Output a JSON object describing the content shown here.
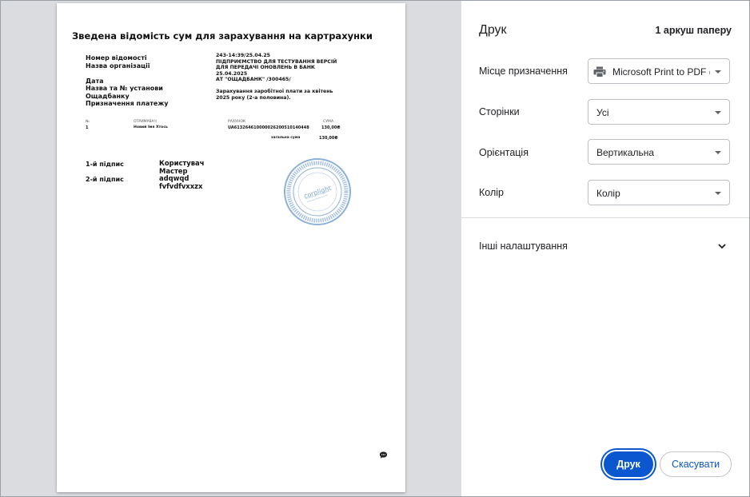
{
  "document": {
    "title": "Зведена відомість сум для зарахування на картрахунки",
    "meta_labels": [
      "Номер відомості",
      "Назва організації",
      "",
      "Дата",
      "Назва та № установи",
      "Ощадбанку",
      "Призначення платежу"
    ],
    "meta_values": {
      "number": "243-14:39/25.04.25",
      "org_line1": "ПІДПРИЄМСТВО ДЛЯ ТЕСТУВАННЯ ВЕРСІЙ",
      "org_line2": "ДЛЯ ПЕРЕДАЧІ ОНОВЛЕНЬ В БАНК",
      "date": "25.04.2025",
      "bank": "АТ \"ОЩАДБАНК\" /300465/",
      "purpose_line1": "Зарахування заробітної плати за квітень",
      "purpose_line2": "2025 року (2-а половина)."
    },
    "table": {
      "headers": [
        "№",
        "ОТРИМУВАЧ",
        "РАХУНОК",
        "СУМА"
      ],
      "rows": [
        [
          "1",
          "Новий Імя Хтось",
          "UA613264610000026200510140448",
          "130,00₴"
        ]
      ],
      "total_label": "загальна сума",
      "total_value": "130,00₴"
    },
    "signatures": {
      "first_label": "1-й підпис",
      "first_value_line1": "Користувач",
      "first_value_line2": "Мастер",
      "second_label": "2-й підпис",
      "second_value_line1": "adqwqd",
      "second_value_line2": "fvfvdfvxxzx"
    },
    "stamp_text": "corplight",
    "icons": {
      "stamp": "stamp-seal",
      "chat": "chat-bubble-icon"
    }
  },
  "panel": {
    "title": "Друк",
    "sheets": "1 аркуш паперу",
    "destination": {
      "label": "Місце призначення",
      "value": "Microsoft Print to PDF (e"
    },
    "pages": {
      "label": "Сторінки",
      "value": "Усі"
    },
    "orientation": {
      "label": "Орієнтація",
      "value": "Вертикальна"
    },
    "color": {
      "label": "Колір",
      "value": "Колір"
    },
    "more_settings": "Інші налаштування",
    "print_button": "Друк",
    "cancel_button": "Скасувати"
  },
  "colors": {
    "accent": "#0b57d0",
    "preview_bg": "#dadce0",
    "stamp": "#7fa7d6"
  }
}
